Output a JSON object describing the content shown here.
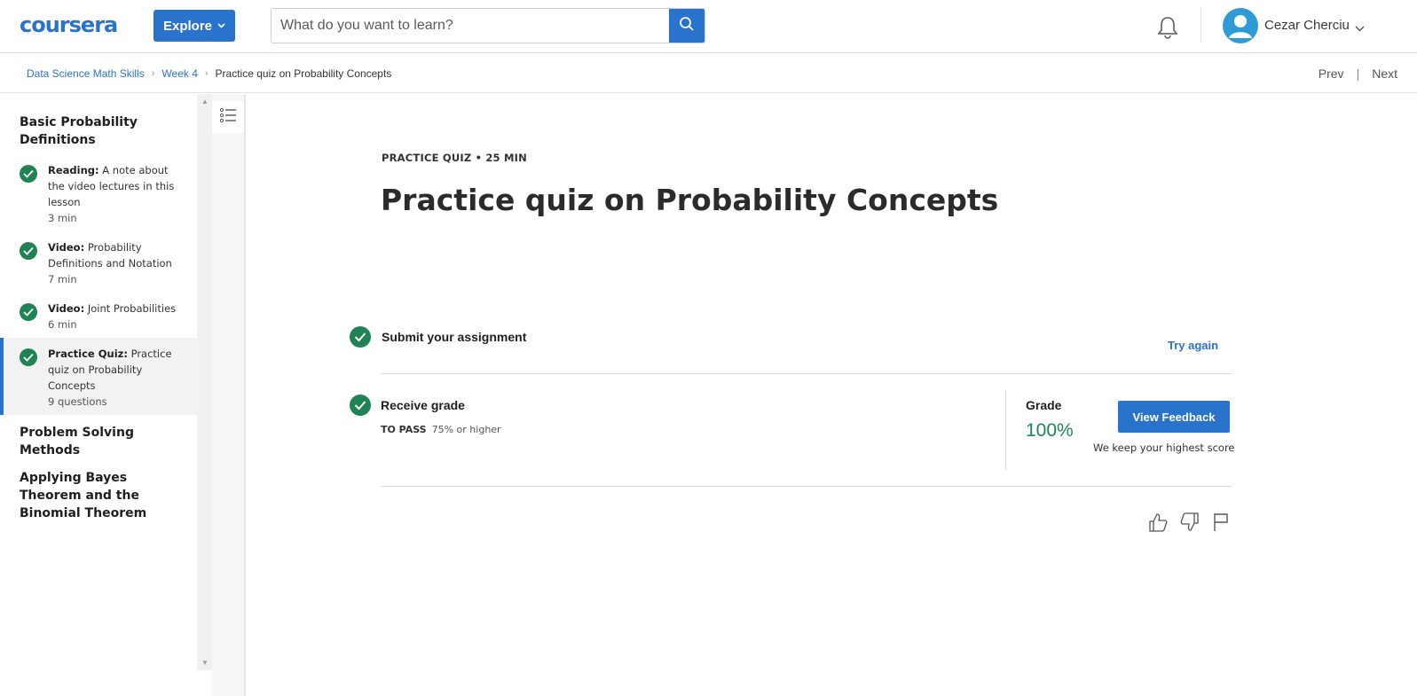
{
  "header": {
    "logo": "coursera",
    "explore_label": "Explore",
    "search_placeholder": "What do you want to learn?",
    "user_name": "Cezar Cherciu",
    "brand_color": "#2a73cc"
  },
  "breadcrumb": {
    "items": [
      "Data Science Math Skills",
      "Week 4"
    ],
    "current": "Practice quiz on Probability Concepts",
    "prev_label": "Prev",
    "next_label": "Next"
  },
  "sidebar": {
    "sections": [
      {
        "title": "Basic Probability Definitions",
        "items": [
          {
            "type": "Reading:",
            "title": "A note about the video lectures in this lesson",
            "meta": "3 min"
          },
          {
            "type": "Video:",
            "title": "Probability Definitions and Notation",
            "meta": "7 min"
          },
          {
            "type": "Video:",
            "title": "Joint Probabilities",
            "meta": "6 min"
          },
          {
            "type": "Practice Quiz:",
            "title": "Practice quiz on Probability Concepts",
            "meta": "9 questions"
          }
        ]
      },
      {
        "title": "Problem Solving Methods"
      },
      {
        "title": "Applying Bayes Theorem and the Binomial Theorem"
      }
    ]
  },
  "main": {
    "eyebrow": "PRACTICE QUIZ • 25 MIN",
    "title": "Practice quiz on Probability Concepts",
    "submit_label": "Submit your assignment",
    "try_again_label": "Try again",
    "receive_label": "Receive grade",
    "to_pass_label": "TO PASS",
    "to_pass_value": "75% or higher",
    "grade_label": "Grade",
    "grade_value": "100%",
    "view_feedback_label": "View Feedback",
    "keep_highest": "We keep your highest score",
    "success_color": "#1f8354"
  }
}
